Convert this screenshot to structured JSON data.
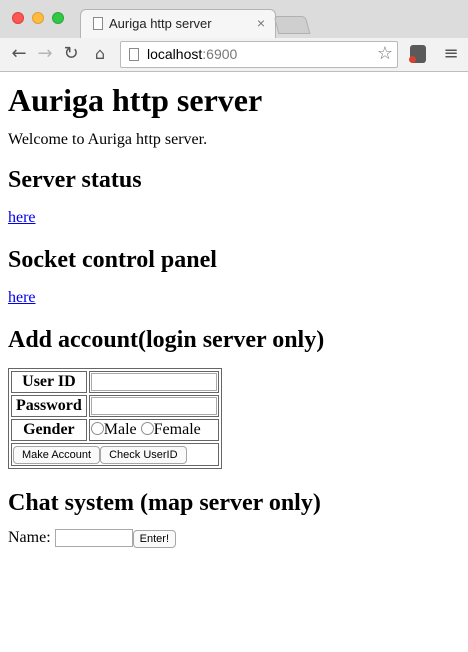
{
  "browser": {
    "tab_title": "Auriga http server",
    "tab_close": "×",
    "url_host": "localhost",
    "url_port": ":6900",
    "icons": {
      "back": "arrow-left-icon",
      "forward": "arrow-right-icon",
      "reload": "reload-icon",
      "home": "home-icon",
      "star": "star-icon",
      "extension": "evernote-icon",
      "menu": "menu-icon"
    }
  },
  "page": {
    "heading": "Auriga http server",
    "welcome": "Welcome to Auriga http server.",
    "server_status": {
      "title": "Server status",
      "link": "here"
    },
    "socket_panel": {
      "title": "Socket control panel",
      "link": "here"
    },
    "add_account": {
      "title": "Add account(login server only)",
      "userid_label": "User ID",
      "userid_value": "",
      "password_label": "Password",
      "password_value": "",
      "gender_label": "Gender",
      "gender_male": "Male",
      "gender_female": "Female",
      "make_button": "Make Account",
      "check_button": "Check UserID"
    },
    "chat": {
      "title": "Chat system (map server only)",
      "name_label": "Name:",
      "name_value": "",
      "enter_button": "Enter!"
    }
  },
  "colors": {
    "link": "#0000ee",
    "close_red": "#fc5753",
    "minimize_yellow": "#fdbc40",
    "zoom_green": "#33c748"
  }
}
